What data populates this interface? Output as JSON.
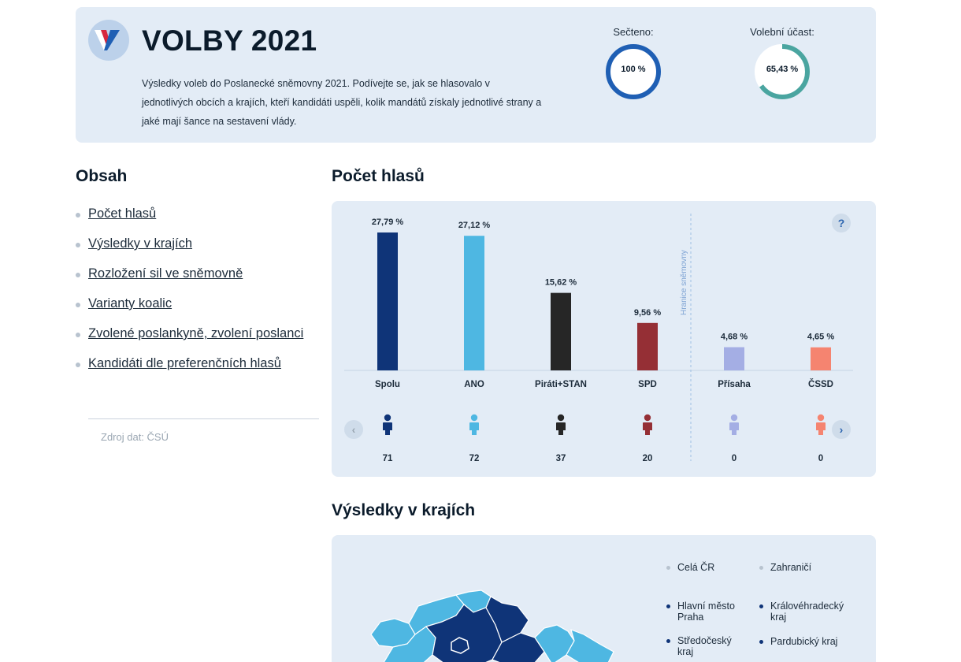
{
  "header": {
    "title": "VOLBY 2021",
    "intro": "Výsledky voleb do Poslanecké sněmovny 2021. Podívejte se, jak se hlasovalo v jednotlivých obcích a krajích, kteří kandidáti uspěli, kolik mandátů získaly jednotlivé strany a jaké mají šance na sestavení vlády.",
    "gauges": [
      {
        "label": "Sečteno:",
        "value_text": "100 %",
        "fraction": 1.0,
        "color": "#1f5fb4"
      },
      {
        "label": "Volební účast:",
        "value_text": "65,43 %",
        "fraction": 0.6543,
        "color": "#4aa5a0"
      }
    ]
  },
  "toc": {
    "title": "Obsah",
    "items": [
      "Počet hlasů",
      "Výsledky v krajích",
      "Rozložení sil ve sněmovně",
      "Varianty koalic",
      "Zvolené poslankyně, zvolení poslanci",
      "Kandidáti dle preferenčních hlasů"
    ],
    "source": "Zdroj dat: ČSÚ"
  },
  "votes": {
    "title": "Počet hlasů",
    "help_label": "?",
    "prev_label": "‹",
    "next_label": "›",
    "threshold_label": "Hranice sněmovny"
  },
  "chart_data": {
    "type": "bar",
    "categories": [
      "Spolu",
      "ANO",
      "Piráti+STAN",
      "SPD",
      "Přísaha",
      "ČSSD"
    ],
    "values": [
      27.79,
      27.12,
      15.62,
      9.56,
      4.68,
      4.65
    ],
    "value_labels": [
      "27,79 %",
      "27,12 %",
      "15,62 %",
      "9,56 %",
      "4,68 %",
      "4,65 %"
    ],
    "seats": [
      71,
      72,
      37,
      20,
      0,
      0
    ],
    "colors": [
      "#0f3478",
      "#4eb7e2",
      "#262626",
      "#952f35",
      "#a4aee4",
      "#f58470"
    ],
    "threshold": 5,
    "ylim": [
      0,
      27.79
    ],
    "title": "Počet hlasů"
  },
  "regions": {
    "title": "Výsledky v krajích",
    "legend": [
      {
        "label": "Celá ČR",
        "color": "#b8c3cf"
      },
      {
        "label": "Zahraničí",
        "color": "#b8c3cf"
      },
      {
        "label": "Hlavní město Praha",
        "color": "#0f3478"
      },
      {
        "label": "Královéhradecký kraj",
        "color": "#0f3478"
      },
      {
        "label": "Středočeský kraj",
        "color": "#0f3478"
      },
      {
        "label": "Pardubický kraj",
        "color": "#0f3478"
      }
    ],
    "map_colors": {
      "spolu": "#0f3478",
      "ano": "#4eb7e2"
    }
  }
}
